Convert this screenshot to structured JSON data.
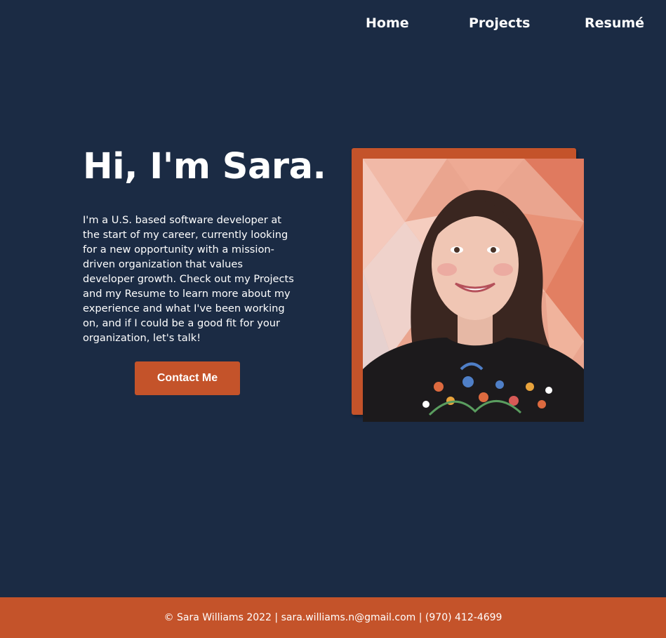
{
  "nav": {
    "items": [
      {
        "label": "Home"
      },
      {
        "label": "Projects"
      },
      {
        "label": "Resumé"
      }
    ]
  },
  "hero": {
    "title": "Hi, I'm Sara.",
    "bio": "I'm a U.S. based software developer at the start of my career, currently looking for a new opportunity with a mission-driven organization that values developer growth. Check out my Projects and my Resume to learn more about my experience and what I've been working on, and if I could be a good fit for your organization, let's talk!",
    "contact_label": "Contact Me"
  },
  "footer": {
    "text": "© Sara Williams 2022 | sara.williams.n@gmail.com | (970) 412-4699"
  },
  "colors": {
    "background": "#1b2b44",
    "accent": "#c4532a",
    "text": "#ffffff"
  }
}
